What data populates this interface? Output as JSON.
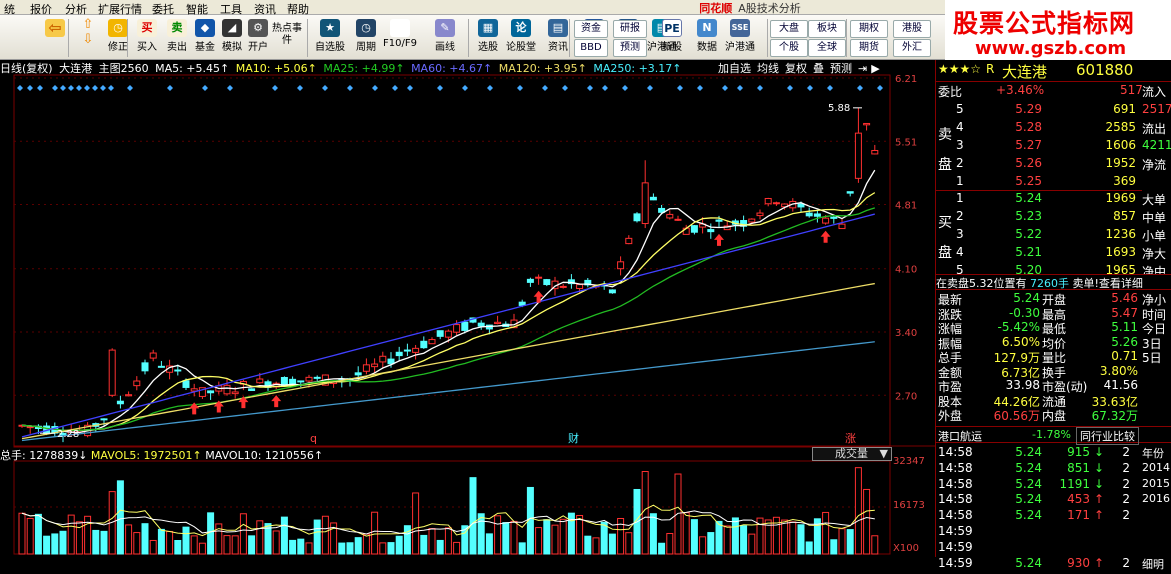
{
  "menu": {
    "items": [
      "统",
      "报价",
      "分析",
      "扩展行情",
      "委托",
      "智能",
      "工具",
      "资讯",
      "帮助"
    ],
    "brand_logo": "同花顺",
    "title": "A股技术分析"
  },
  "watermark": {
    "line1": "股票公式指标网",
    "line2": "www.gszb.com"
  },
  "toolbar": {
    "nav_buttons": [
      "",
      "修正"
    ],
    "buttons": [
      "买入",
      "卖出",
      "基金",
      "模拟",
      "开户",
      "热点事件",
      "自选股",
      "周期",
      "F10/F9",
      "画线",
      "选股",
      "论股堂",
      "资讯",
      "研报",
      "预测",
      "数据",
      "新股",
      "沪港通",
      "大盘",
      "个股",
      "板块",
      "全球",
      "期权",
      "期货",
      "港股",
      "外汇"
    ],
    "small_left": [
      "资金",
      "BBD"
    ],
    "small_pe": "PE"
  },
  "infobar": {
    "period": "日线(复权)",
    "stock": "大连港",
    "mode": "主图2560",
    "ma5": "MA5: +5.45↑",
    "ma10": "MA10: +5.06↑",
    "ma25": "MA25: +4.99↑",
    "ma60": "MA60: +4.67↑",
    "ma120": "MA120: +3.95↑",
    "ma250": "MA250: +3.17↑",
    "tools": [
      "加自选",
      "均线",
      "复权",
      "叠",
      "预测"
    ]
  },
  "chart_data": {
    "type": "candlestick",
    "price_ticks": [
      "6.21",
      "5.51",
      "4.81",
      "4.10",
      "3.40",
      "2.70"
    ],
    "ylim": [
      2.15,
      6.21
    ],
    "max_label": "5.88",
    "min_label": "2.28",
    "markers": [
      "q",
      "财",
      "涨"
    ],
    "volume_ticks": [
      "32347",
      "16173",
      "X100"
    ],
    "volume_label": "成交量",
    "volume_header": {
      "total": "总手: 1278839↓",
      "mavol5": "MAVOL5: 1972501↑",
      "mavol10": "MAVOL10: 1210556↑"
    },
    "colors": {
      "up": "#ff3030",
      "down": "#54ffff",
      "ma5": "#ffffff",
      "ma10": "#ffff66",
      "ma25": "#22bb22",
      "ma60": "#4040ff",
      "ma120": "#eedd66",
      "ma250": "#4499cc"
    }
  },
  "quote": {
    "stars": "★★★☆",
    "r": "R",
    "name": "大连港",
    "code": "601880",
    "webi_label": "委比",
    "webi_val": "+3.46%",
    "webi_num": "517",
    "sell_label": "卖盘",
    "buy_label": "买盘",
    "sells": [
      {
        "lv": "5",
        "p": "5.29",
        "v": "691"
      },
      {
        "lv": "4",
        "p": "5.28",
        "v": "2585"
      },
      {
        "lv": "3",
        "p": "5.27",
        "v": "1606"
      },
      {
        "lv": "2",
        "p": "5.26",
        "v": "1952"
      },
      {
        "lv": "1",
        "p": "5.25",
        "v": "369"
      }
    ],
    "buys": [
      {
        "lv": "1",
        "p": "5.24",
        "v": "1969"
      },
      {
        "lv": "2",
        "p": "5.23",
        "v": "857"
      },
      {
        "lv": "3",
        "p": "5.22",
        "v": "1236"
      },
      {
        "lv": "4",
        "p": "5.21",
        "v": "1693"
      },
      {
        "lv": "5",
        "p": "5.20",
        "v": "1965"
      }
    ],
    "status": {
      "left": "在卖盘5.32位置有",
      "mid": "7260手",
      "right": "卖单!查看详细"
    },
    "stats": [
      {
        "a": "最新",
        "av": "5.24",
        "ac": "grn",
        "b": "开盘",
        "bv": "5.46",
        "bc": "red"
      },
      {
        "a": "涨跌",
        "av": "-0.30",
        "ac": "grn",
        "b": "最高",
        "bv": "5.47",
        "bc": "red"
      },
      {
        "a": "涨幅",
        "av": "-5.42%",
        "ac": "grn",
        "b": "最低",
        "bv": "5.11",
        "bc": "grn"
      },
      {
        "a": "振幅",
        "av": "6.50%",
        "ac": "yel",
        "b": "均价",
        "bv": "5.26",
        "bc": "grn"
      },
      {
        "a": "总手",
        "av": "127.9万",
        "ac": "yel",
        "b": "量比",
        "bv": "0.71",
        "bc": "yel"
      },
      {
        "a": "金额",
        "av": "6.73亿",
        "ac": "yel",
        "b": "换手",
        "bv": "3.80%",
        "bc": "yel"
      },
      {
        "a": "市盈",
        "av": "33.98",
        "ac": "wht",
        "b": "市盈(动)",
        "bv": "41.56",
        "bc": "wht"
      },
      {
        "a": "股本",
        "av": "44.26亿",
        "ac": "yel",
        "b": "流通",
        "bv": "33.63亿",
        "bc": "yel"
      },
      {
        "a": "外盘",
        "av": "60.56万",
        "ac": "red",
        "b": "内盘",
        "bv": "67.32万",
        "bc": "grn"
      }
    ],
    "hk": {
      "label": "港口航运",
      "pct": "-1.78%",
      "btn": "同行业比较"
    },
    "ticks": [
      {
        "t": "14:58",
        "p": "5.24",
        "v": "915",
        "d": "↓",
        "c": "grn",
        "n": "2"
      },
      {
        "t": "14:58",
        "p": "5.24",
        "v": "851",
        "d": "↓",
        "c": "grn",
        "n": "2"
      },
      {
        "t": "14:58",
        "p": "5.24",
        "v": "1191",
        "d": "↓",
        "c": "grn",
        "n": "2"
      },
      {
        "t": "14:58",
        "p": "5.24",
        "v": "453",
        "d": "↑",
        "c": "red",
        "n": "2"
      },
      {
        "t": "14:58",
        "p": "5.24",
        "v": "171",
        "d": "↑",
        "c": "red",
        "n": "2"
      },
      {
        "t": "14:59",
        "p": "",
        "v": "",
        "d": "",
        "c": "grn",
        "n": ""
      },
      {
        "t": "14:59",
        "p": "",
        "v": "",
        "d": "",
        "c": "grn",
        "n": ""
      },
      {
        "t": "14:59",
        "p": "5.24",
        "v": "930",
        "d": "↑",
        "c": "red",
        "n": "2"
      }
    ],
    "side1": [
      "流入",
      "2517",
      "流出",
      "4211",
      "净流",
      "",
      "大单",
      "中单",
      "小单",
      "净大",
      "净中",
      "净小",
      "时间",
      "今日",
      "3日",
      "5日"
    ],
    "side2": [
      "年份",
      "2014",
      "2015",
      "2016",
      "",
      "",
      "",
      "细明"
    ]
  }
}
